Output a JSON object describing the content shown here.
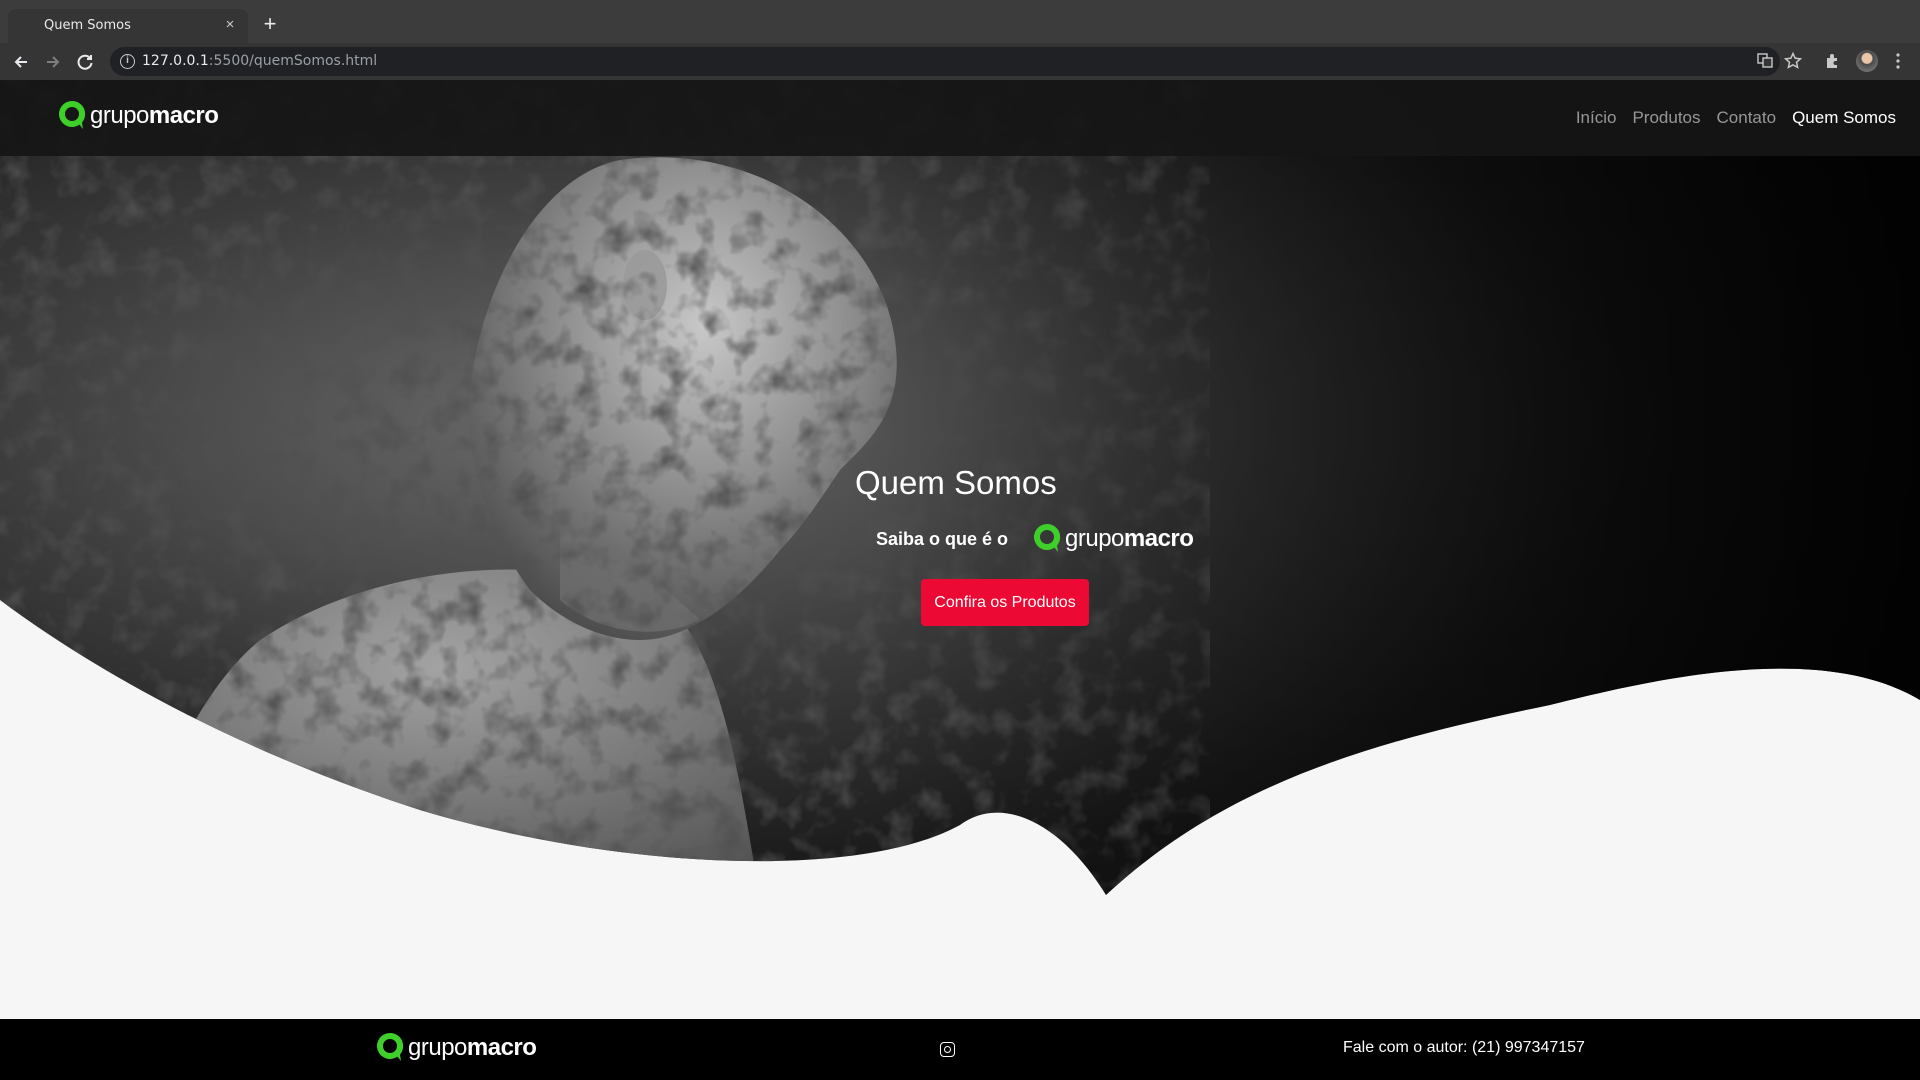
{
  "browser": {
    "tab_title": "Quem Somos",
    "tab_close": "×",
    "new_tab": "+",
    "url_host": "127.0.0.1",
    "url_rest": ":5500/quemSomos.html",
    "back_icon": "arrow-left",
    "forward_icon": "arrow-right",
    "reload_icon": "reload",
    "info_icon": "info",
    "translate_icon": "translate",
    "bookmark_icon": "star",
    "extensions_icon": "puzzle",
    "menu_icon": "kebab-menu"
  },
  "navbar": {
    "brand": {
      "light": "grupo",
      "bold": "macro"
    },
    "links": [
      {
        "label": "Início",
        "active": false
      },
      {
        "label": "Produtos",
        "active": false
      },
      {
        "label": "Contato",
        "active": false
      },
      {
        "label": "Quem Somos",
        "active": true
      }
    ]
  },
  "hero": {
    "title": "Quem Somos",
    "subtitle": "Saiba o que é o",
    "logo": {
      "light": "grupo",
      "bold": "macro"
    },
    "cta_label": "Confira os Produtos"
  },
  "footer": {
    "logo": {
      "light": "grupo",
      "bold": "macro"
    },
    "social_icon": "instagram",
    "contact_text": "Fale com o autor: (21) 997347157"
  },
  "colors": {
    "brand_green": "#3ecf2a",
    "cta_red": "#ec0a34",
    "navbar_bg": "#161616",
    "page_bg": "#f6f6f6"
  }
}
